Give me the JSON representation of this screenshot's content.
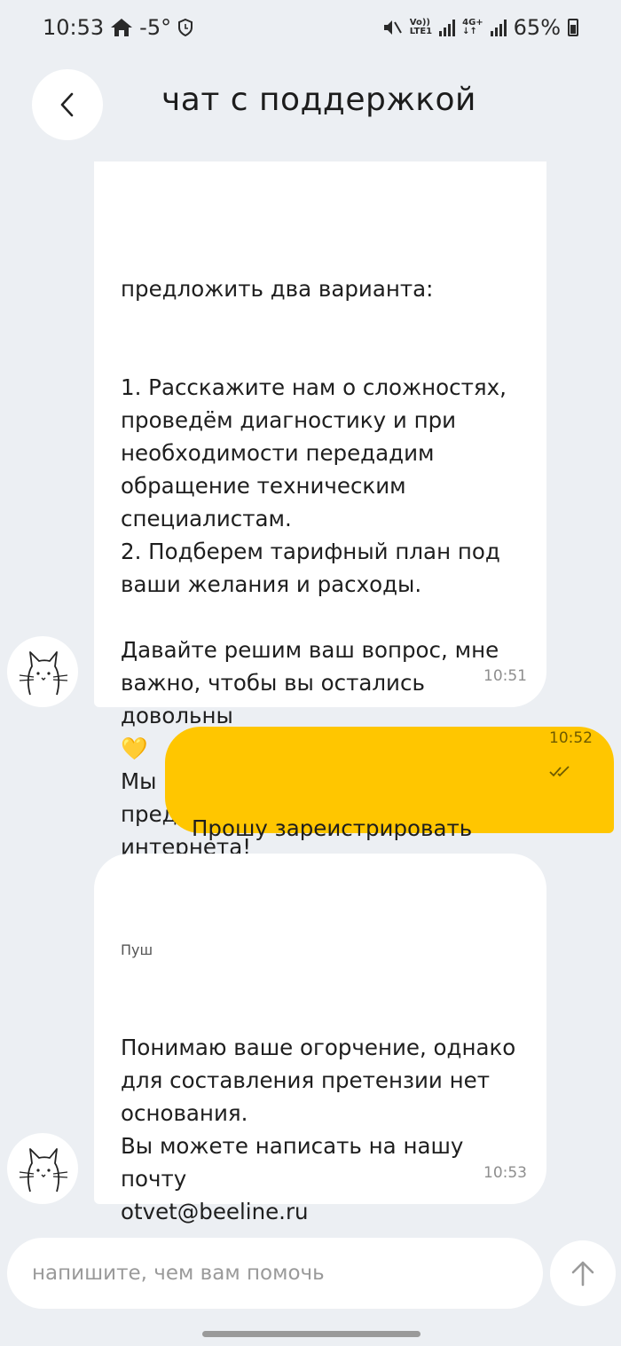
{
  "status_bar": {
    "time": "10:53",
    "temperature": "-5°",
    "volte_top": "Vo))",
    "volte_bottom": "LTE1",
    "net_top": "4G+",
    "net_bottom": "↓↑",
    "battery": "65%"
  },
  "header": {
    "title": "чат с поддержкой"
  },
  "messages": [
    {
      "direction": "incoming",
      "partial_top": "предложить два варианта:",
      "text": "1. Расскажите нам о сложностях,\nпроведём диагностику и при\nнеобходимости передадим\nобращение техническим\nспециалистам.\n2. Подберем тарифный план под\nваши желания и расходы.\n\nДавайте решим ваш вопрос, мне\nважно, чтобы вы остались довольны\n💛\nМы рады заботиться о вас,\nпредоставляя услуги связи и\nинтернета!",
      "time": "10:51"
    },
    {
      "direction": "outgoing",
      "text": "Прошу зареистрировать притензию",
      "time": "10:52"
    },
    {
      "direction": "incoming",
      "sender": "Пуш",
      "text": "Понимаю ваше огорчение, однако\nдля составления претензии нет\nоснования.\nВы можете написать на нашу почту\notvet@beeline.ru\nВ письме уточните ваш номер, ФИО\nи серию номер паспорта владельца,\nа так же суть вопроса/претензии.",
      "time": "10:53"
    }
  ],
  "composer": {
    "placeholder": "напишите, чем вам помочь"
  },
  "colors": {
    "background": "#eceff3",
    "outgoing_bubble": "#ffc600",
    "incoming_bubble": "#ffffff"
  }
}
